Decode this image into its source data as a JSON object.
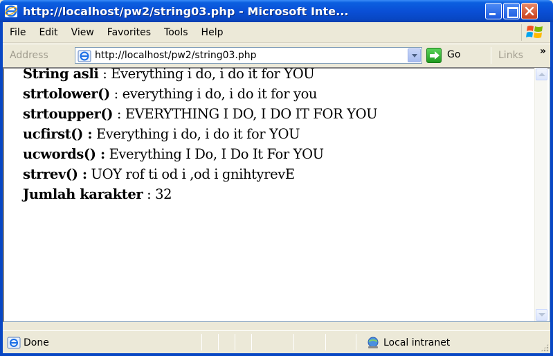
{
  "window": {
    "title": "http://localhost/pw2/string03.php - Microsoft Inte..."
  },
  "menu": {
    "items": [
      "File",
      "Edit",
      "View",
      "Favorites",
      "Tools",
      "Help"
    ]
  },
  "address_bar": {
    "label": "Address",
    "url": "http://localhost/pw2/string03.php",
    "go_label": "Go",
    "links_label": "Links",
    "links_more": "»"
  },
  "content": {
    "lines": [
      {
        "label": "String asli",
        "sep": " : ",
        "value": "Everything i do, i do it for YOU"
      },
      {
        "label": "strtolower()",
        "sep": " : ",
        "value": "everything i do, i do it for you"
      },
      {
        "label": "strtoupper()",
        "sep": " : ",
        "value": "EVERYTHING I DO, I DO IT FOR YOU"
      },
      {
        "label": "ucfirst() :",
        "sep": " ",
        "value": "Everything i do, i do it for YOU"
      },
      {
        "label": "ucwords() :",
        "sep": " ",
        "value": "Everything I Do, I Do It For YOU"
      },
      {
        "label": "strrev() :",
        "sep": " ",
        "value": "UOY rof ti od i ,od i gnihtyrevE"
      },
      {
        "label": "Jumlah karakter",
        "sep": " : ",
        "value": "32"
      }
    ]
  },
  "status_bar": {
    "status": "Done",
    "zone": "Local intranet"
  },
  "colors": {
    "titlebar": "#0a4fd6",
    "chrome": "#ece9d8",
    "content_bg": "#ffffff"
  }
}
